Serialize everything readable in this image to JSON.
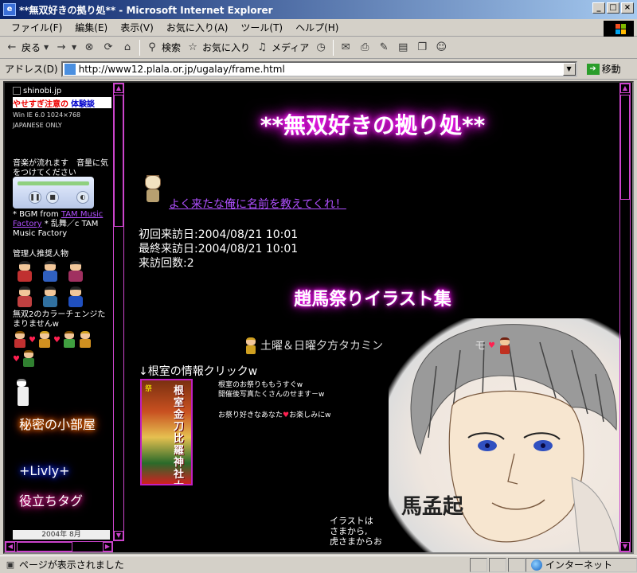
{
  "window": {
    "title": "**無双好きの拠り処** - Microsoft Internet Explorer",
    "buttons": {
      "minimize": "_",
      "maximize": "□",
      "close": "×"
    }
  },
  "menu": [
    "ファイル(F)",
    "編集(E)",
    "表示(V)",
    "お気に入り(A)",
    "ツール(T)",
    "ヘルプ(H)"
  ],
  "toolbar": {
    "back": "戻る",
    "search": "検索",
    "favorites": "お気に入り",
    "media": "メディア"
  },
  "address": {
    "label": "アドレス(D)",
    "url": "http://www12.plala.or.jp/ugalay/frame.html",
    "go": "移動"
  },
  "sidebar": {
    "shinobi": "shinobi.jp",
    "banner_red": "やせすぎ注意の",
    "banner_blue": "体験談",
    "os_info": "Win IE 6.0 1024×768",
    "japanese_only": "JAPANESE ONLY",
    "music_notice": "音楽が流れます　音量に気をつけてください",
    "bgm_prefix": "* BGM from ",
    "bgm_link": "TAM Music Factory",
    "bgm_suffix": " * 乱舞／c TAM Music Factory",
    "recommend_label": "管理人推奨人物",
    "color_change": "無双2のカラーチェンジたまりませんw",
    "secret_room": "秘密の小部屋",
    "livly": "+Livly+",
    "useful_tags": "役立ちタグ",
    "counter": "2004年 8月"
  },
  "main": {
    "site_title": "**無双好きの拠り処**",
    "name_link": "よく来たな俺に名前を教えてくれ！",
    "first_visit": "初回来訪日:2004/08/21 10:01",
    "last_visit": "最終来訪日:2004/08/21 10:01",
    "visit_count": "来訪回数:2",
    "illust_title": "趙馬祭りイラスト集",
    "weekend_line": "土曜＆日曜夕方タカミン",
    "weekend_tail": "モ",
    "nemuro_heading": "↓根室の情報クリックw",
    "poster_vertical": "根室金刀比羅神社大祭",
    "nemuro_line1": "根室のお祭りももうすぐw",
    "nemuro_line2": "開催後写真たくさんのせます－w",
    "nemuro_line3_a": "お祭り好きなあなた",
    "nemuro_line3_b": "お楽しみにw",
    "illust_caption": "馬孟起",
    "illust_note1": "イラストは",
    "illust_note2": "さまから,",
    "illust_note3": "虎さまからお"
  },
  "status": {
    "text": "ページが表示されました",
    "zone": "インターネット"
  },
  "colors": {
    "glow_pink": "#ff20ff",
    "link_purple": "#b050ff",
    "scroll_magenta": "#cc44cc"
  }
}
